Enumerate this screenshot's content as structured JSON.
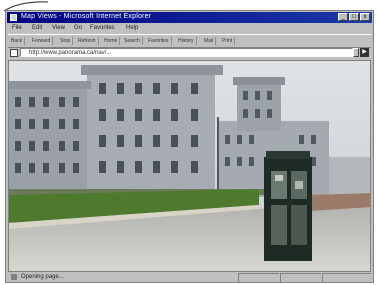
{
  "window": {
    "title": "Map Views - Microsoft Internet Explorer",
    "controls": {
      "minimize": "_",
      "maximize": "□",
      "close": "x"
    }
  },
  "menu": [
    "File",
    "Edit",
    "View",
    "Go",
    "Favorites",
    "Help"
  ],
  "toolbar": [
    "Back",
    "Forward",
    "Stop",
    "Refresh",
    "Home",
    "Search",
    "Favorites",
    "History",
    "Mail",
    "Print"
  ],
  "address": {
    "value": "http://www.panorama.ca/nav/...",
    "go_label": "▶"
  },
  "status": {
    "text": "Opening page..."
  },
  "scene": {
    "description_icons": [
      "globe-icon"
    ]
  }
}
